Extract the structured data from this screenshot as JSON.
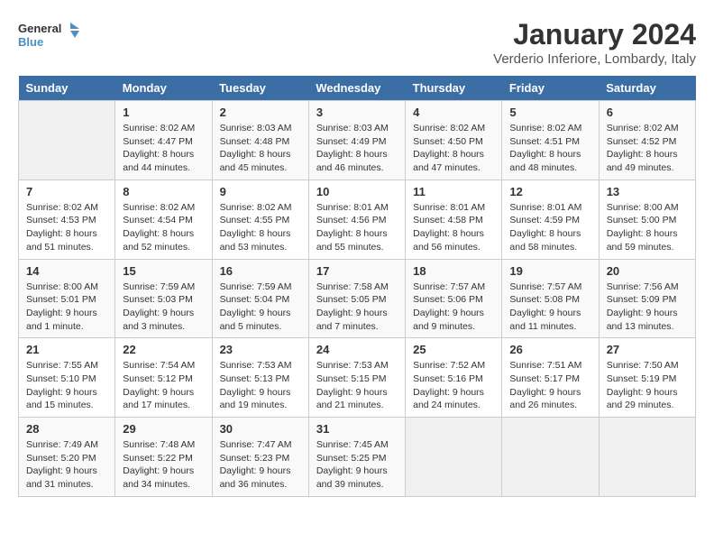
{
  "logo": {
    "text_general": "General",
    "text_blue": "Blue"
  },
  "title": "January 2024",
  "subtitle": "Verderio Inferiore, Lombardy, Italy",
  "days_header": [
    "Sunday",
    "Monday",
    "Tuesday",
    "Wednesday",
    "Thursday",
    "Friday",
    "Saturday"
  ],
  "weeks": [
    [
      {
        "day": "",
        "sunrise": "",
        "sunset": "",
        "daylight": ""
      },
      {
        "day": "1",
        "sunrise": "Sunrise: 8:02 AM",
        "sunset": "Sunset: 4:47 PM",
        "daylight": "Daylight: 8 hours and 44 minutes."
      },
      {
        "day": "2",
        "sunrise": "Sunrise: 8:03 AM",
        "sunset": "Sunset: 4:48 PM",
        "daylight": "Daylight: 8 hours and 45 minutes."
      },
      {
        "day": "3",
        "sunrise": "Sunrise: 8:03 AM",
        "sunset": "Sunset: 4:49 PM",
        "daylight": "Daylight: 8 hours and 46 minutes."
      },
      {
        "day": "4",
        "sunrise": "Sunrise: 8:02 AM",
        "sunset": "Sunset: 4:50 PM",
        "daylight": "Daylight: 8 hours and 47 minutes."
      },
      {
        "day": "5",
        "sunrise": "Sunrise: 8:02 AM",
        "sunset": "Sunset: 4:51 PM",
        "daylight": "Daylight: 8 hours and 48 minutes."
      },
      {
        "day": "6",
        "sunrise": "Sunrise: 8:02 AM",
        "sunset": "Sunset: 4:52 PM",
        "daylight": "Daylight: 8 hours and 49 minutes."
      }
    ],
    [
      {
        "day": "7",
        "sunrise": "Sunrise: 8:02 AM",
        "sunset": "Sunset: 4:53 PM",
        "daylight": "Daylight: 8 hours and 51 minutes."
      },
      {
        "day": "8",
        "sunrise": "Sunrise: 8:02 AM",
        "sunset": "Sunset: 4:54 PM",
        "daylight": "Daylight: 8 hours and 52 minutes."
      },
      {
        "day": "9",
        "sunrise": "Sunrise: 8:02 AM",
        "sunset": "Sunset: 4:55 PM",
        "daylight": "Daylight: 8 hours and 53 minutes."
      },
      {
        "day": "10",
        "sunrise": "Sunrise: 8:01 AM",
        "sunset": "Sunset: 4:56 PM",
        "daylight": "Daylight: 8 hours and 55 minutes."
      },
      {
        "day": "11",
        "sunrise": "Sunrise: 8:01 AM",
        "sunset": "Sunset: 4:58 PM",
        "daylight": "Daylight: 8 hours and 56 minutes."
      },
      {
        "day": "12",
        "sunrise": "Sunrise: 8:01 AM",
        "sunset": "Sunset: 4:59 PM",
        "daylight": "Daylight: 8 hours and 58 minutes."
      },
      {
        "day": "13",
        "sunrise": "Sunrise: 8:00 AM",
        "sunset": "Sunset: 5:00 PM",
        "daylight": "Daylight: 8 hours and 59 minutes."
      }
    ],
    [
      {
        "day": "14",
        "sunrise": "Sunrise: 8:00 AM",
        "sunset": "Sunset: 5:01 PM",
        "daylight": "Daylight: 9 hours and 1 minute."
      },
      {
        "day": "15",
        "sunrise": "Sunrise: 7:59 AM",
        "sunset": "Sunset: 5:03 PM",
        "daylight": "Daylight: 9 hours and 3 minutes."
      },
      {
        "day": "16",
        "sunrise": "Sunrise: 7:59 AM",
        "sunset": "Sunset: 5:04 PM",
        "daylight": "Daylight: 9 hours and 5 minutes."
      },
      {
        "day": "17",
        "sunrise": "Sunrise: 7:58 AM",
        "sunset": "Sunset: 5:05 PM",
        "daylight": "Daylight: 9 hours and 7 minutes."
      },
      {
        "day": "18",
        "sunrise": "Sunrise: 7:57 AM",
        "sunset": "Sunset: 5:06 PM",
        "daylight": "Daylight: 9 hours and 9 minutes."
      },
      {
        "day": "19",
        "sunrise": "Sunrise: 7:57 AM",
        "sunset": "Sunset: 5:08 PM",
        "daylight": "Daylight: 9 hours and 11 minutes."
      },
      {
        "day": "20",
        "sunrise": "Sunrise: 7:56 AM",
        "sunset": "Sunset: 5:09 PM",
        "daylight": "Daylight: 9 hours and 13 minutes."
      }
    ],
    [
      {
        "day": "21",
        "sunrise": "Sunrise: 7:55 AM",
        "sunset": "Sunset: 5:10 PM",
        "daylight": "Daylight: 9 hours and 15 minutes."
      },
      {
        "day": "22",
        "sunrise": "Sunrise: 7:54 AM",
        "sunset": "Sunset: 5:12 PM",
        "daylight": "Daylight: 9 hours and 17 minutes."
      },
      {
        "day": "23",
        "sunrise": "Sunrise: 7:53 AM",
        "sunset": "Sunset: 5:13 PM",
        "daylight": "Daylight: 9 hours and 19 minutes."
      },
      {
        "day": "24",
        "sunrise": "Sunrise: 7:53 AM",
        "sunset": "Sunset: 5:15 PM",
        "daylight": "Daylight: 9 hours and 21 minutes."
      },
      {
        "day": "25",
        "sunrise": "Sunrise: 7:52 AM",
        "sunset": "Sunset: 5:16 PM",
        "daylight": "Daylight: 9 hours and 24 minutes."
      },
      {
        "day": "26",
        "sunrise": "Sunrise: 7:51 AM",
        "sunset": "Sunset: 5:17 PM",
        "daylight": "Daylight: 9 hours and 26 minutes."
      },
      {
        "day": "27",
        "sunrise": "Sunrise: 7:50 AM",
        "sunset": "Sunset: 5:19 PM",
        "daylight": "Daylight: 9 hours and 29 minutes."
      }
    ],
    [
      {
        "day": "28",
        "sunrise": "Sunrise: 7:49 AM",
        "sunset": "Sunset: 5:20 PM",
        "daylight": "Daylight: 9 hours and 31 minutes."
      },
      {
        "day": "29",
        "sunrise": "Sunrise: 7:48 AM",
        "sunset": "Sunset: 5:22 PM",
        "daylight": "Daylight: 9 hours and 34 minutes."
      },
      {
        "day": "30",
        "sunrise": "Sunrise: 7:47 AM",
        "sunset": "Sunset: 5:23 PM",
        "daylight": "Daylight: 9 hours and 36 minutes."
      },
      {
        "day": "31",
        "sunrise": "Sunrise: 7:45 AM",
        "sunset": "Sunset: 5:25 PM",
        "daylight": "Daylight: 9 hours and 39 minutes."
      },
      {
        "day": "",
        "sunrise": "",
        "sunset": "",
        "daylight": ""
      },
      {
        "day": "",
        "sunrise": "",
        "sunset": "",
        "daylight": ""
      },
      {
        "day": "",
        "sunrise": "",
        "sunset": "",
        "daylight": ""
      }
    ]
  ]
}
